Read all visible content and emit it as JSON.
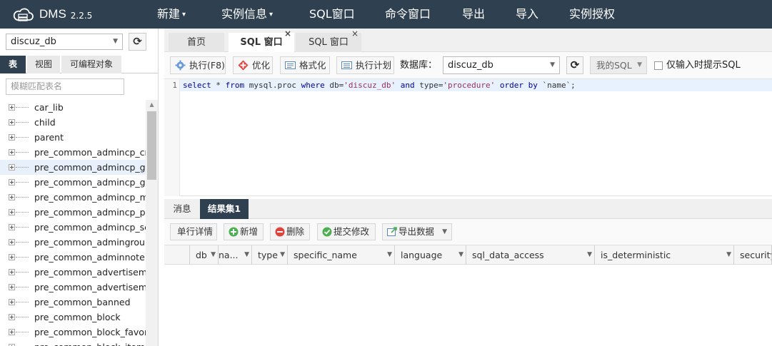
{
  "app": {
    "name": "DMS",
    "version": "2.2.5"
  },
  "nav": [
    {
      "label": "新建",
      "has_caret": true
    },
    {
      "label": "实例信息",
      "has_caret": true
    },
    {
      "label": "SQL窗口",
      "has_caret": false
    },
    {
      "label": "命令窗口",
      "has_caret": false
    },
    {
      "label": "导出",
      "has_caret": false
    },
    {
      "label": "导入",
      "has_caret": false
    },
    {
      "label": "实例授权",
      "has_caret": false
    }
  ],
  "left": {
    "database": "discuz_db",
    "tabs": [
      "表",
      "视图",
      "可编程对象"
    ],
    "filter_placeholder": "模糊匹配表名",
    "tables": [
      "car_lib",
      "child",
      "parent",
      "pre_common_admincp_cmd",
      "pre_common_admincp_group",
      "pre_common_admincp_grouppe",
      "pre_common_admincp_member",
      "pre_common_admincp_perm",
      "pre_common_admincp_session",
      "pre_common_admingroup",
      "pre_common_adminnote",
      "pre_common_advertisement",
      "pre_common_advertisement_cu",
      "pre_common_banned",
      "pre_common_block",
      "pre_common_block_favorite",
      "pre_common_block_item"
    ],
    "selected_index": 4
  },
  "tabs": [
    {
      "label": "首页",
      "closable": false,
      "active": false
    },
    {
      "label": "SQL 窗口",
      "closable": true,
      "active": true
    },
    {
      "label": "SQL 窗口",
      "closable": true,
      "active": false
    }
  ],
  "toolbar": {
    "run": "执行(F8)",
    "optimize": "优化",
    "format": "格式化",
    "plan": "执行计划",
    "db_label": "数据库：",
    "db_value": "discuz_db",
    "my_sql": "我的SQL",
    "hint_only": "仅输入时提示SQL"
  },
  "editor": {
    "line_number": "1",
    "tokens": [
      {
        "t": "select",
        "c": "kw"
      },
      {
        "t": " * ",
        "c": "idn"
      },
      {
        "t": "from",
        "c": "kw"
      },
      {
        "t": " mysql.proc ",
        "c": "idn"
      },
      {
        "t": "where",
        "c": "kw"
      },
      {
        "t": " db=",
        "c": "idn"
      },
      {
        "t": "'discuz_db'",
        "c": "str"
      },
      {
        "t": " ",
        "c": "idn"
      },
      {
        "t": "and",
        "c": "kw"
      },
      {
        "t": " type=",
        "c": "idn"
      },
      {
        "t": "'procedure'",
        "c": "str"
      },
      {
        "t": " ",
        "c": "idn"
      },
      {
        "t": "order",
        "c": "kw"
      },
      {
        "t": " ",
        "c": "idn"
      },
      {
        "t": "by",
        "c": "kw"
      },
      {
        "t": " `name`;",
        "c": "idn"
      }
    ]
  },
  "result_tabs": [
    "消息",
    "结果集1"
  ],
  "result_toolbar": {
    "detail": "单行详情",
    "add": "新增",
    "delete": "删除",
    "commit": "提交修改",
    "export": "导出数据"
  },
  "columns": [
    "db",
    "na...",
    "type",
    "specific_name",
    "language",
    "sql_data_access",
    "is_deterministic",
    "security"
  ],
  "colors": {
    "nav_bg": "#2f4050",
    "accent_green": "#4caf50",
    "delete_red": "#e0433b"
  }
}
